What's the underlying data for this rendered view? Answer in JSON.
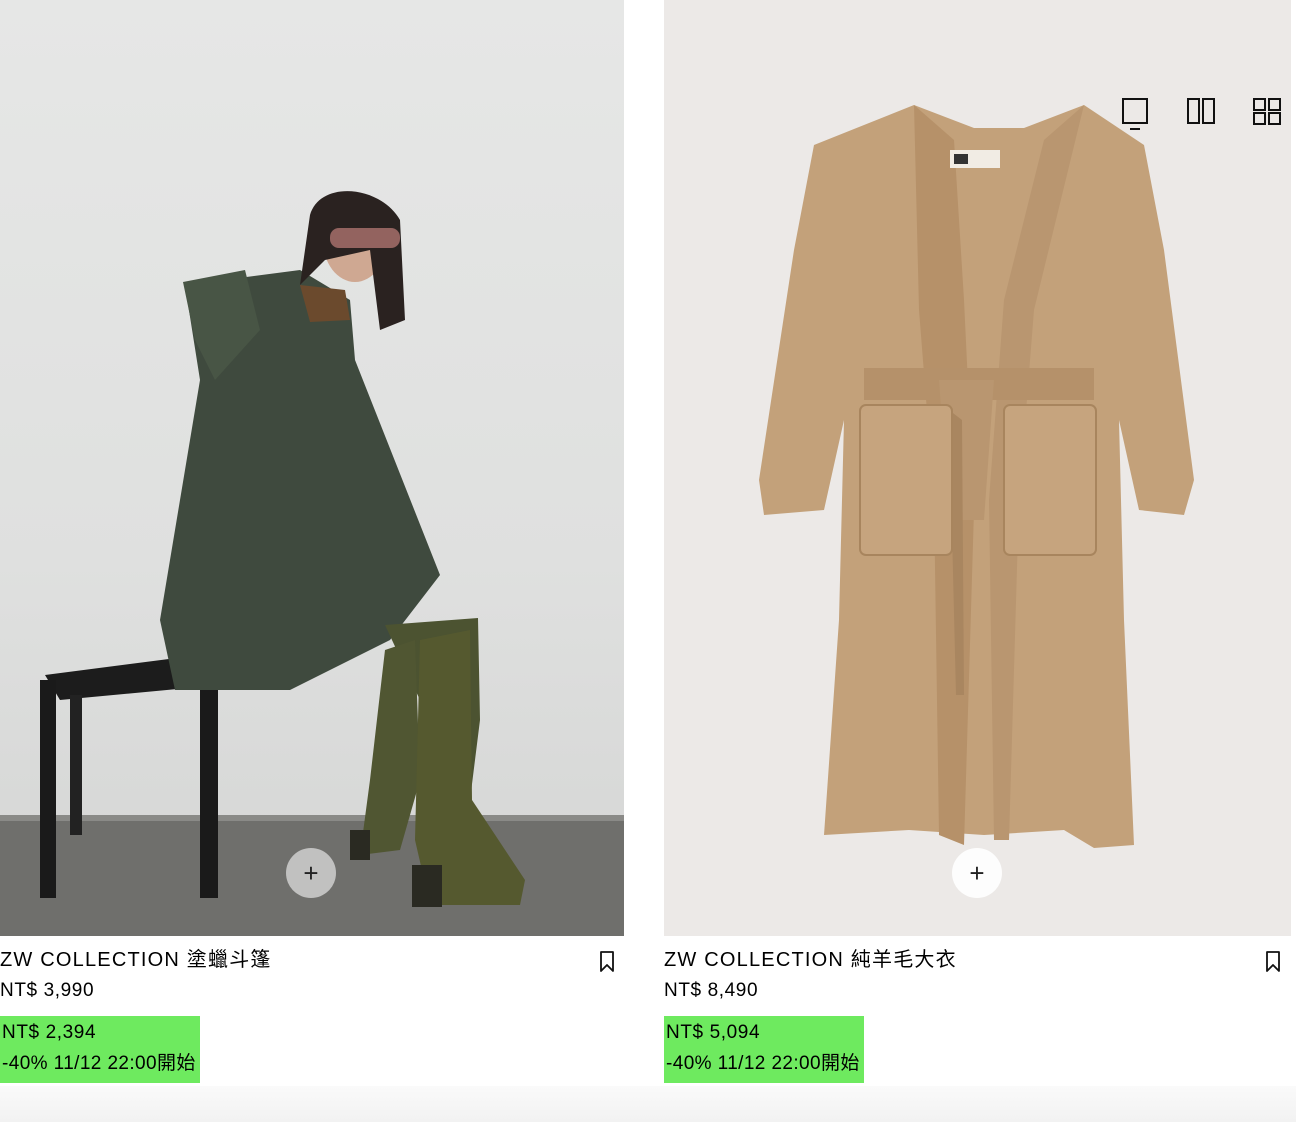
{
  "products": [
    {
      "title": "ZW COLLECTION 塗蠟斗篷",
      "price": "NT$ 3,990",
      "sale_price": "NT$ 2,394",
      "sale_note": "-40% 11/12 22:00開始",
      "add_label": "+"
    },
    {
      "title": "ZW COLLECTION 純羊毛大衣",
      "price": "NT$ 8,490",
      "sale_price": "NT$ 5,094",
      "sale_note": "-40% 11/12 22:00開始",
      "add_label": "+"
    }
  ],
  "view_options": [
    "single-view-icon",
    "double-view-icon",
    "grid-view-icon"
  ],
  "colors": {
    "sale_highlight": "#6eea5f",
    "text": "#000000"
  }
}
